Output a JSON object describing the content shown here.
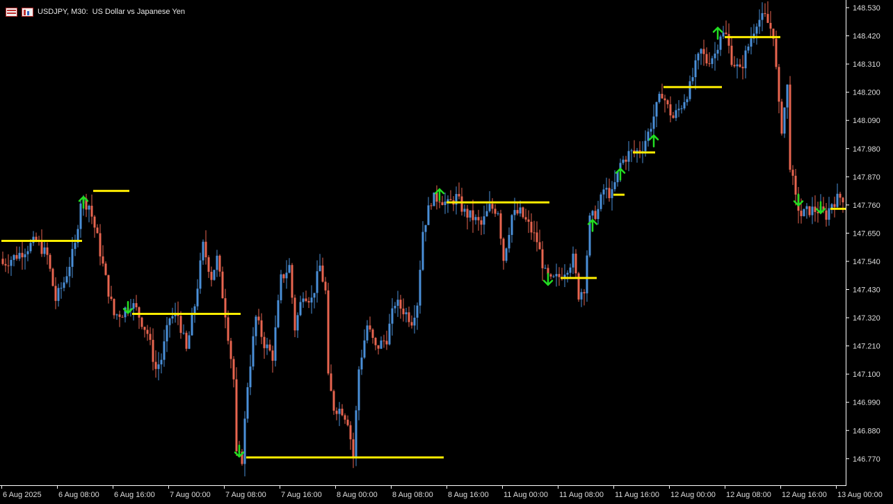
{
  "header": {
    "symbol": "USDJPY",
    "timeframe": "M30",
    "description": "US Dollar vs Japanese Yen",
    "title": "USDJPY, M30:  US Dollar vs Japanese Yen"
  },
  "colors": {
    "background": "#000000",
    "bull": "#4a8fd8",
    "bear": "#e8654f",
    "level": "#ffee00",
    "arrow": "#22dd22",
    "axis": "#ffffff"
  },
  "chart_data": {
    "type": "candlestick",
    "grid": false,
    "y_axis": {
      "position": "right",
      "ticks": [
        "148.530",
        "148.420",
        "148.310",
        "148.200",
        "148.090",
        "147.980",
        "147.870",
        "147.760",
        "147.650",
        "147.540",
        "147.430",
        "147.320",
        "147.210",
        "147.100",
        "146.990",
        "146.880",
        "146.770"
      ],
      "ylim": [
        146.7,
        148.56
      ]
    },
    "x_axis": {
      "ticks": [
        "6 Aug 2025",
        "6 Aug 08:00",
        "6 Aug 16:00",
        "7 Aug 00:00",
        "7 Aug 08:00",
        "7 Aug 16:00",
        "8 Aug 00:00",
        "8 Aug 08:00",
        "8 Aug 16:00",
        "11 Aug 00:00",
        "11 Aug 08:00",
        "11 Aug 16:00",
        "12 Aug 00:00",
        "12 Aug 08:00",
        "12 Aug 16:00",
        "13 Aug 00:00"
      ],
      "bars_between_ticks": 16
    },
    "close_path": [
      [
        0,
        147.53
      ],
      [
        6,
        147.57
      ],
      [
        12,
        147.62
      ],
      [
        16,
        147.56
      ],
      [
        19,
        147.39
      ],
      [
        22,
        147.46
      ],
      [
        26,
        147.6
      ],
      [
        28,
        147.78
      ],
      [
        31,
        147.76
      ],
      [
        34,
        147.63
      ],
      [
        37,
        147.47
      ],
      [
        40,
        147.33
      ],
      [
        43,
        147.34
      ],
      [
        46,
        147.38
      ],
      [
        48,
        147.35
      ],
      [
        52,
        147.26
      ],
      [
        55,
        147.12
      ],
      [
        57,
        147.16
      ],
      [
        60,
        147.32
      ],
      [
        63,
        147.33
      ],
      [
        66,
        147.19
      ],
      [
        69,
        147.37
      ],
      [
        72,
        147.6
      ],
      [
        75,
        147.48
      ],
      [
        77,
        147.55
      ],
      [
        80,
        147.34
      ],
      [
        83,
        147.08
      ],
      [
        84,
        146.78
      ],
      [
        86,
        146.77
      ],
      [
        88,
        147.06
      ],
      [
        91,
        147.32
      ],
      [
        94,
        147.22
      ],
      [
        97,
        147.17
      ],
      [
        100,
        147.47
      ],
      [
        103,
        147.52
      ],
      [
        105,
        147.28
      ],
      [
        108,
        147.42
      ],
      [
        111,
        147.39
      ],
      [
        114,
        147.52
      ],
      [
        116,
        147.42
      ],
      [
        117,
        147.08
      ],
      [
        119,
        146.97
      ],
      [
        122,
        146.96
      ],
      [
        124,
        146.92
      ],
      [
        126,
        146.78
      ],
      [
        128,
        147.12
      ],
      [
        131,
        147.29
      ],
      [
        134,
        147.2
      ],
      [
        138,
        147.24
      ],
      [
        141,
        147.38
      ],
      [
        144,
        147.35
      ],
      [
        147,
        147.31
      ],
      [
        149,
        147.38
      ],
      [
        151,
        147.66
      ],
      [
        154,
        147.78
      ],
      [
        157,
        147.79
      ],
      [
        160,
        147.76
      ],
      [
        163,
        147.79
      ],
      [
        166,
        147.73
      ],
      [
        169,
        147.71
      ],
      [
        172,
        147.68
      ],
      [
        175,
        147.75
      ],
      [
        178,
        147.74
      ],
      [
        180,
        147.55
      ],
      [
        183,
        147.72
      ],
      [
        186,
        147.73
      ],
      [
        189,
        147.68
      ],
      [
        192,
        147.62
      ],
      [
        195,
        147.49
      ],
      [
        197,
        147.46
      ],
      [
        200,
        147.48
      ],
      [
        203,
        147.52
      ],
      [
        205,
        147.55
      ],
      [
        207,
        147.41
      ],
      [
        209,
        147.44
      ],
      [
        211,
        147.7
      ],
      [
        214,
        147.74
      ],
      [
        216,
        147.82
      ],
      [
        219,
        147.8
      ],
      [
        222,
        147.92
      ],
      [
        225,
        147.96
      ],
      [
        228,
        147.97
      ],
      [
        230,
        147.99
      ],
      [
        232,
        148.04
      ],
      [
        235,
        148.14
      ],
      [
        237,
        148.2
      ],
      [
        239,
        148.14
      ],
      [
        241,
        148.1
      ],
      [
        244,
        148.15
      ],
      [
        247,
        148.22
      ],
      [
        249,
        148.3
      ],
      [
        251,
        148.36
      ],
      [
        253,
        148.32
      ],
      [
        256,
        148.35
      ],
      [
        258,
        148.43
      ],
      [
        260,
        148.42
      ],
      [
        262,
        148.33
      ],
      [
        265,
        148.28
      ],
      [
        268,
        148.38
      ],
      [
        271,
        148.48
      ],
      [
        274,
        148.49
      ],
      [
        277,
        148.43
      ],
      [
        279,
        148.14
      ],
      [
        280,
        148.06
      ],
      [
        282,
        148.22
      ],
      [
        283,
        147.92
      ],
      [
        285,
        147.78
      ],
      [
        287,
        147.72
      ],
      [
        290,
        147.74
      ],
      [
        293,
        147.74
      ],
      [
        296,
        147.72
      ],
      [
        298,
        147.77
      ],
      [
        301,
        147.79
      ],
      [
        302,
        147.79
      ]
    ],
    "level_lines": [
      {
        "price": 147.62,
        "start_bar": 0,
        "end_bar": 28
      },
      {
        "price": 147.815,
        "start_bar": 33,
        "end_bar": 45
      },
      {
        "price": 147.335,
        "start_bar": 47,
        "end_bar": 85
      },
      {
        "price": 146.775,
        "start_bar": 88,
        "end_bar": 158
      },
      {
        "price": 147.77,
        "start_bar": 160,
        "end_bar": 196
      },
      {
        "price": 147.475,
        "start_bar": 201,
        "end_bar": 213
      },
      {
        "price": 147.8,
        "start_bar": 220,
        "end_bar": 223
      },
      {
        "price": 147.965,
        "start_bar": 227,
        "end_bar": 234
      },
      {
        "price": 148.22,
        "start_bar": 238,
        "end_bar": 258
      },
      {
        "price": 148.415,
        "start_bar": 260,
        "end_bar": 279
      },
      {
        "price": 147.745,
        "start_bar": 298,
        "end_bar": 303
      }
    ],
    "arrows": [
      {
        "bar": 29,
        "dir": "up",
        "price": 147.77
      },
      {
        "bar": 45,
        "dir": "down",
        "price": 147.36
      },
      {
        "bar": 85,
        "dir": "down",
        "price": 146.8
      },
      {
        "bar": 157,
        "dir": "up",
        "price": 147.8
      },
      {
        "bar": 196,
        "dir": "down",
        "price": 147.47
      },
      {
        "bar": 212,
        "dir": "up",
        "price": 147.68
      },
      {
        "bar": 222,
        "dir": "up",
        "price": 147.88
      },
      {
        "bar": 234,
        "dir": "up",
        "price": 148.01
      },
      {
        "bar": 257,
        "dir": "up",
        "price": 148.43
      },
      {
        "bar": 286,
        "dir": "down",
        "price": 147.78
      },
      {
        "bar": 294,
        "dir": "down",
        "price": 147.75
      }
    ]
  }
}
